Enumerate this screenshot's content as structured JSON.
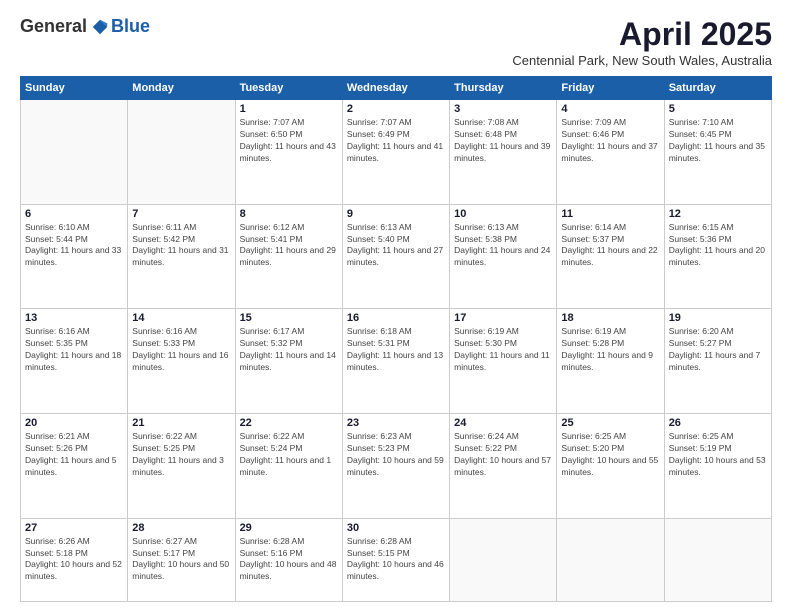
{
  "header": {
    "logo_general": "General",
    "logo_blue": "Blue",
    "month_title": "April 2025",
    "subtitle": "Centennial Park, New South Wales, Australia"
  },
  "weekdays": [
    "Sunday",
    "Monday",
    "Tuesday",
    "Wednesday",
    "Thursday",
    "Friday",
    "Saturday"
  ],
  "weeks": [
    [
      {
        "day": "",
        "info": ""
      },
      {
        "day": "",
        "info": ""
      },
      {
        "day": "1",
        "info": "Sunrise: 7:07 AM\nSunset: 6:50 PM\nDaylight: 11 hours and 43 minutes."
      },
      {
        "day": "2",
        "info": "Sunrise: 7:07 AM\nSunset: 6:49 PM\nDaylight: 11 hours and 41 minutes."
      },
      {
        "day": "3",
        "info": "Sunrise: 7:08 AM\nSunset: 6:48 PM\nDaylight: 11 hours and 39 minutes."
      },
      {
        "day": "4",
        "info": "Sunrise: 7:09 AM\nSunset: 6:46 PM\nDaylight: 11 hours and 37 minutes."
      },
      {
        "day": "5",
        "info": "Sunrise: 7:10 AM\nSunset: 6:45 PM\nDaylight: 11 hours and 35 minutes."
      }
    ],
    [
      {
        "day": "6",
        "info": "Sunrise: 6:10 AM\nSunset: 5:44 PM\nDaylight: 11 hours and 33 minutes."
      },
      {
        "day": "7",
        "info": "Sunrise: 6:11 AM\nSunset: 5:42 PM\nDaylight: 11 hours and 31 minutes."
      },
      {
        "day": "8",
        "info": "Sunrise: 6:12 AM\nSunset: 5:41 PM\nDaylight: 11 hours and 29 minutes."
      },
      {
        "day": "9",
        "info": "Sunrise: 6:13 AM\nSunset: 5:40 PM\nDaylight: 11 hours and 27 minutes."
      },
      {
        "day": "10",
        "info": "Sunrise: 6:13 AM\nSunset: 5:38 PM\nDaylight: 11 hours and 24 minutes."
      },
      {
        "day": "11",
        "info": "Sunrise: 6:14 AM\nSunset: 5:37 PM\nDaylight: 11 hours and 22 minutes."
      },
      {
        "day": "12",
        "info": "Sunrise: 6:15 AM\nSunset: 5:36 PM\nDaylight: 11 hours and 20 minutes."
      }
    ],
    [
      {
        "day": "13",
        "info": "Sunrise: 6:16 AM\nSunset: 5:35 PM\nDaylight: 11 hours and 18 minutes."
      },
      {
        "day": "14",
        "info": "Sunrise: 6:16 AM\nSunset: 5:33 PM\nDaylight: 11 hours and 16 minutes."
      },
      {
        "day": "15",
        "info": "Sunrise: 6:17 AM\nSunset: 5:32 PM\nDaylight: 11 hours and 14 minutes."
      },
      {
        "day": "16",
        "info": "Sunrise: 6:18 AM\nSunset: 5:31 PM\nDaylight: 11 hours and 13 minutes."
      },
      {
        "day": "17",
        "info": "Sunrise: 6:19 AM\nSunset: 5:30 PM\nDaylight: 11 hours and 11 minutes."
      },
      {
        "day": "18",
        "info": "Sunrise: 6:19 AM\nSunset: 5:28 PM\nDaylight: 11 hours and 9 minutes."
      },
      {
        "day": "19",
        "info": "Sunrise: 6:20 AM\nSunset: 5:27 PM\nDaylight: 11 hours and 7 minutes."
      }
    ],
    [
      {
        "day": "20",
        "info": "Sunrise: 6:21 AM\nSunset: 5:26 PM\nDaylight: 11 hours and 5 minutes."
      },
      {
        "day": "21",
        "info": "Sunrise: 6:22 AM\nSunset: 5:25 PM\nDaylight: 11 hours and 3 minutes."
      },
      {
        "day": "22",
        "info": "Sunrise: 6:22 AM\nSunset: 5:24 PM\nDaylight: 11 hours and 1 minute."
      },
      {
        "day": "23",
        "info": "Sunrise: 6:23 AM\nSunset: 5:23 PM\nDaylight: 10 hours and 59 minutes."
      },
      {
        "day": "24",
        "info": "Sunrise: 6:24 AM\nSunset: 5:22 PM\nDaylight: 10 hours and 57 minutes."
      },
      {
        "day": "25",
        "info": "Sunrise: 6:25 AM\nSunset: 5:20 PM\nDaylight: 10 hours and 55 minutes."
      },
      {
        "day": "26",
        "info": "Sunrise: 6:25 AM\nSunset: 5:19 PM\nDaylight: 10 hours and 53 minutes."
      }
    ],
    [
      {
        "day": "27",
        "info": "Sunrise: 6:26 AM\nSunset: 5:18 PM\nDaylight: 10 hours and 52 minutes."
      },
      {
        "day": "28",
        "info": "Sunrise: 6:27 AM\nSunset: 5:17 PM\nDaylight: 10 hours and 50 minutes."
      },
      {
        "day": "29",
        "info": "Sunrise: 6:28 AM\nSunset: 5:16 PM\nDaylight: 10 hours and 48 minutes."
      },
      {
        "day": "30",
        "info": "Sunrise: 6:28 AM\nSunset: 5:15 PM\nDaylight: 10 hours and 46 minutes."
      },
      {
        "day": "",
        "info": ""
      },
      {
        "day": "",
        "info": ""
      },
      {
        "day": "",
        "info": ""
      }
    ]
  ]
}
